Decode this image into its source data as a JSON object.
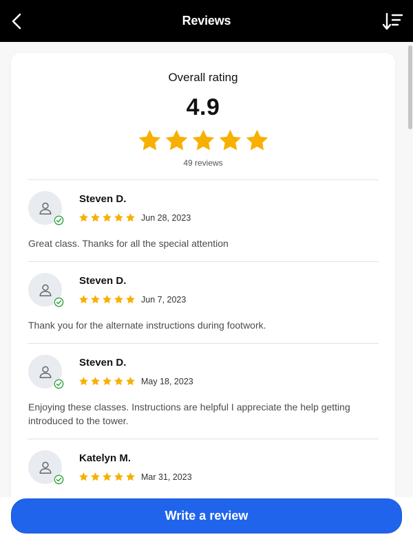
{
  "header": {
    "title": "Reviews",
    "back_icon": "chevron-left-icon",
    "sort_icon": "sort-descending-icon"
  },
  "summary": {
    "label": "Overall rating",
    "score": "4.9",
    "stars_filled": 5,
    "stars_total": 5,
    "review_count": "49 reviews"
  },
  "reviews": [
    {
      "name": "Steven D.",
      "date": "Jun 28, 2023",
      "rating": 5,
      "text": "Great class. Thanks for all the special attention"
    },
    {
      "name": "Steven D.",
      "date": "Jun 7, 2023",
      "rating": 5,
      "text": "Thank you for the alternate instructions during footwork."
    },
    {
      "name": "Steven D.",
      "date": "May 18, 2023",
      "rating": 5,
      "text": "Enjoying these classes. Instructions are helpful I appreciate the help getting introduced to the tower."
    },
    {
      "name": "Katelyn M.",
      "date": "Mar 31, 2023",
      "rating": 5,
      "text": ""
    }
  ],
  "footer": {
    "write_review_label": "Write a review"
  },
  "colors": {
    "header_bg": "#000000",
    "star": "#f7b000",
    "verified": "#2a9d3a",
    "primary_button": "#1f64ea"
  }
}
